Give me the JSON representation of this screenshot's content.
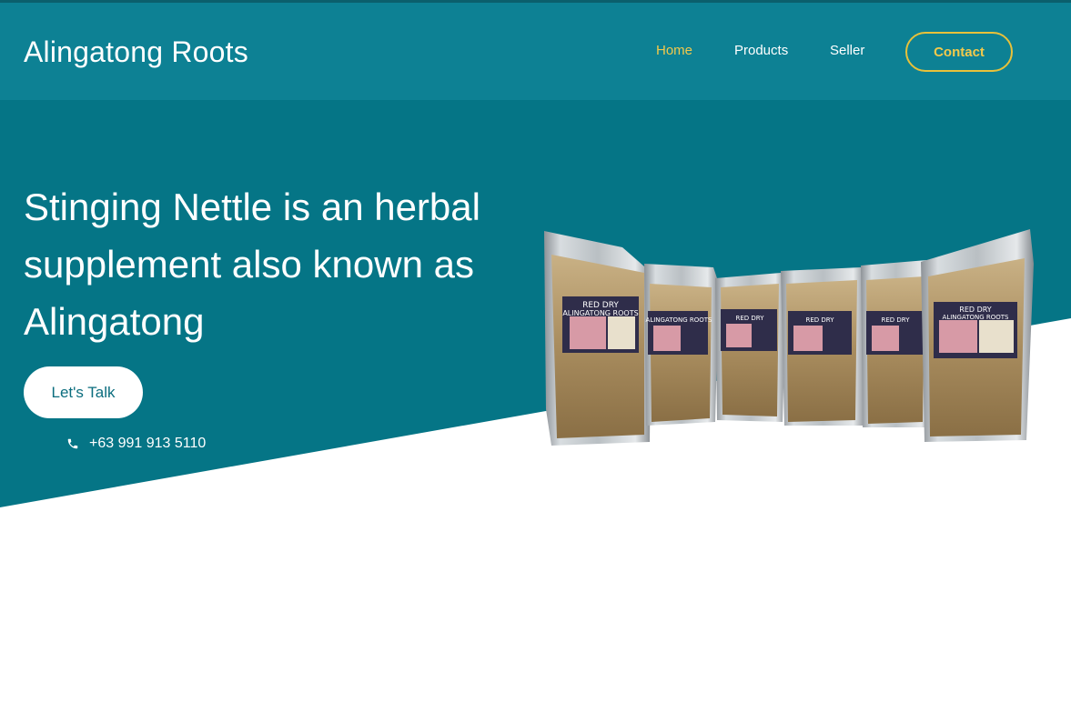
{
  "header": {
    "brand": "Alingatong Roots",
    "nav": {
      "home": "Home",
      "products": "Products",
      "seller": "Seller"
    },
    "contact_label": "Contact"
  },
  "hero": {
    "title": "Stinging Nettle is an herbal supplement also known as Alingatong",
    "cta_label": "Let's Talk",
    "phone": "+63 991 913 5110",
    "phone_icon": "phone-icon",
    "product_labels": [
      "RED DRY ALINGATONG ROOTS"
    ]
  },
  "colors": {
    "header_bg": "#0d8194",
    "hero_bg": "#057586",
    "accent": "#f2c94c",
    "text_light": "#ffffff"
  }
}
